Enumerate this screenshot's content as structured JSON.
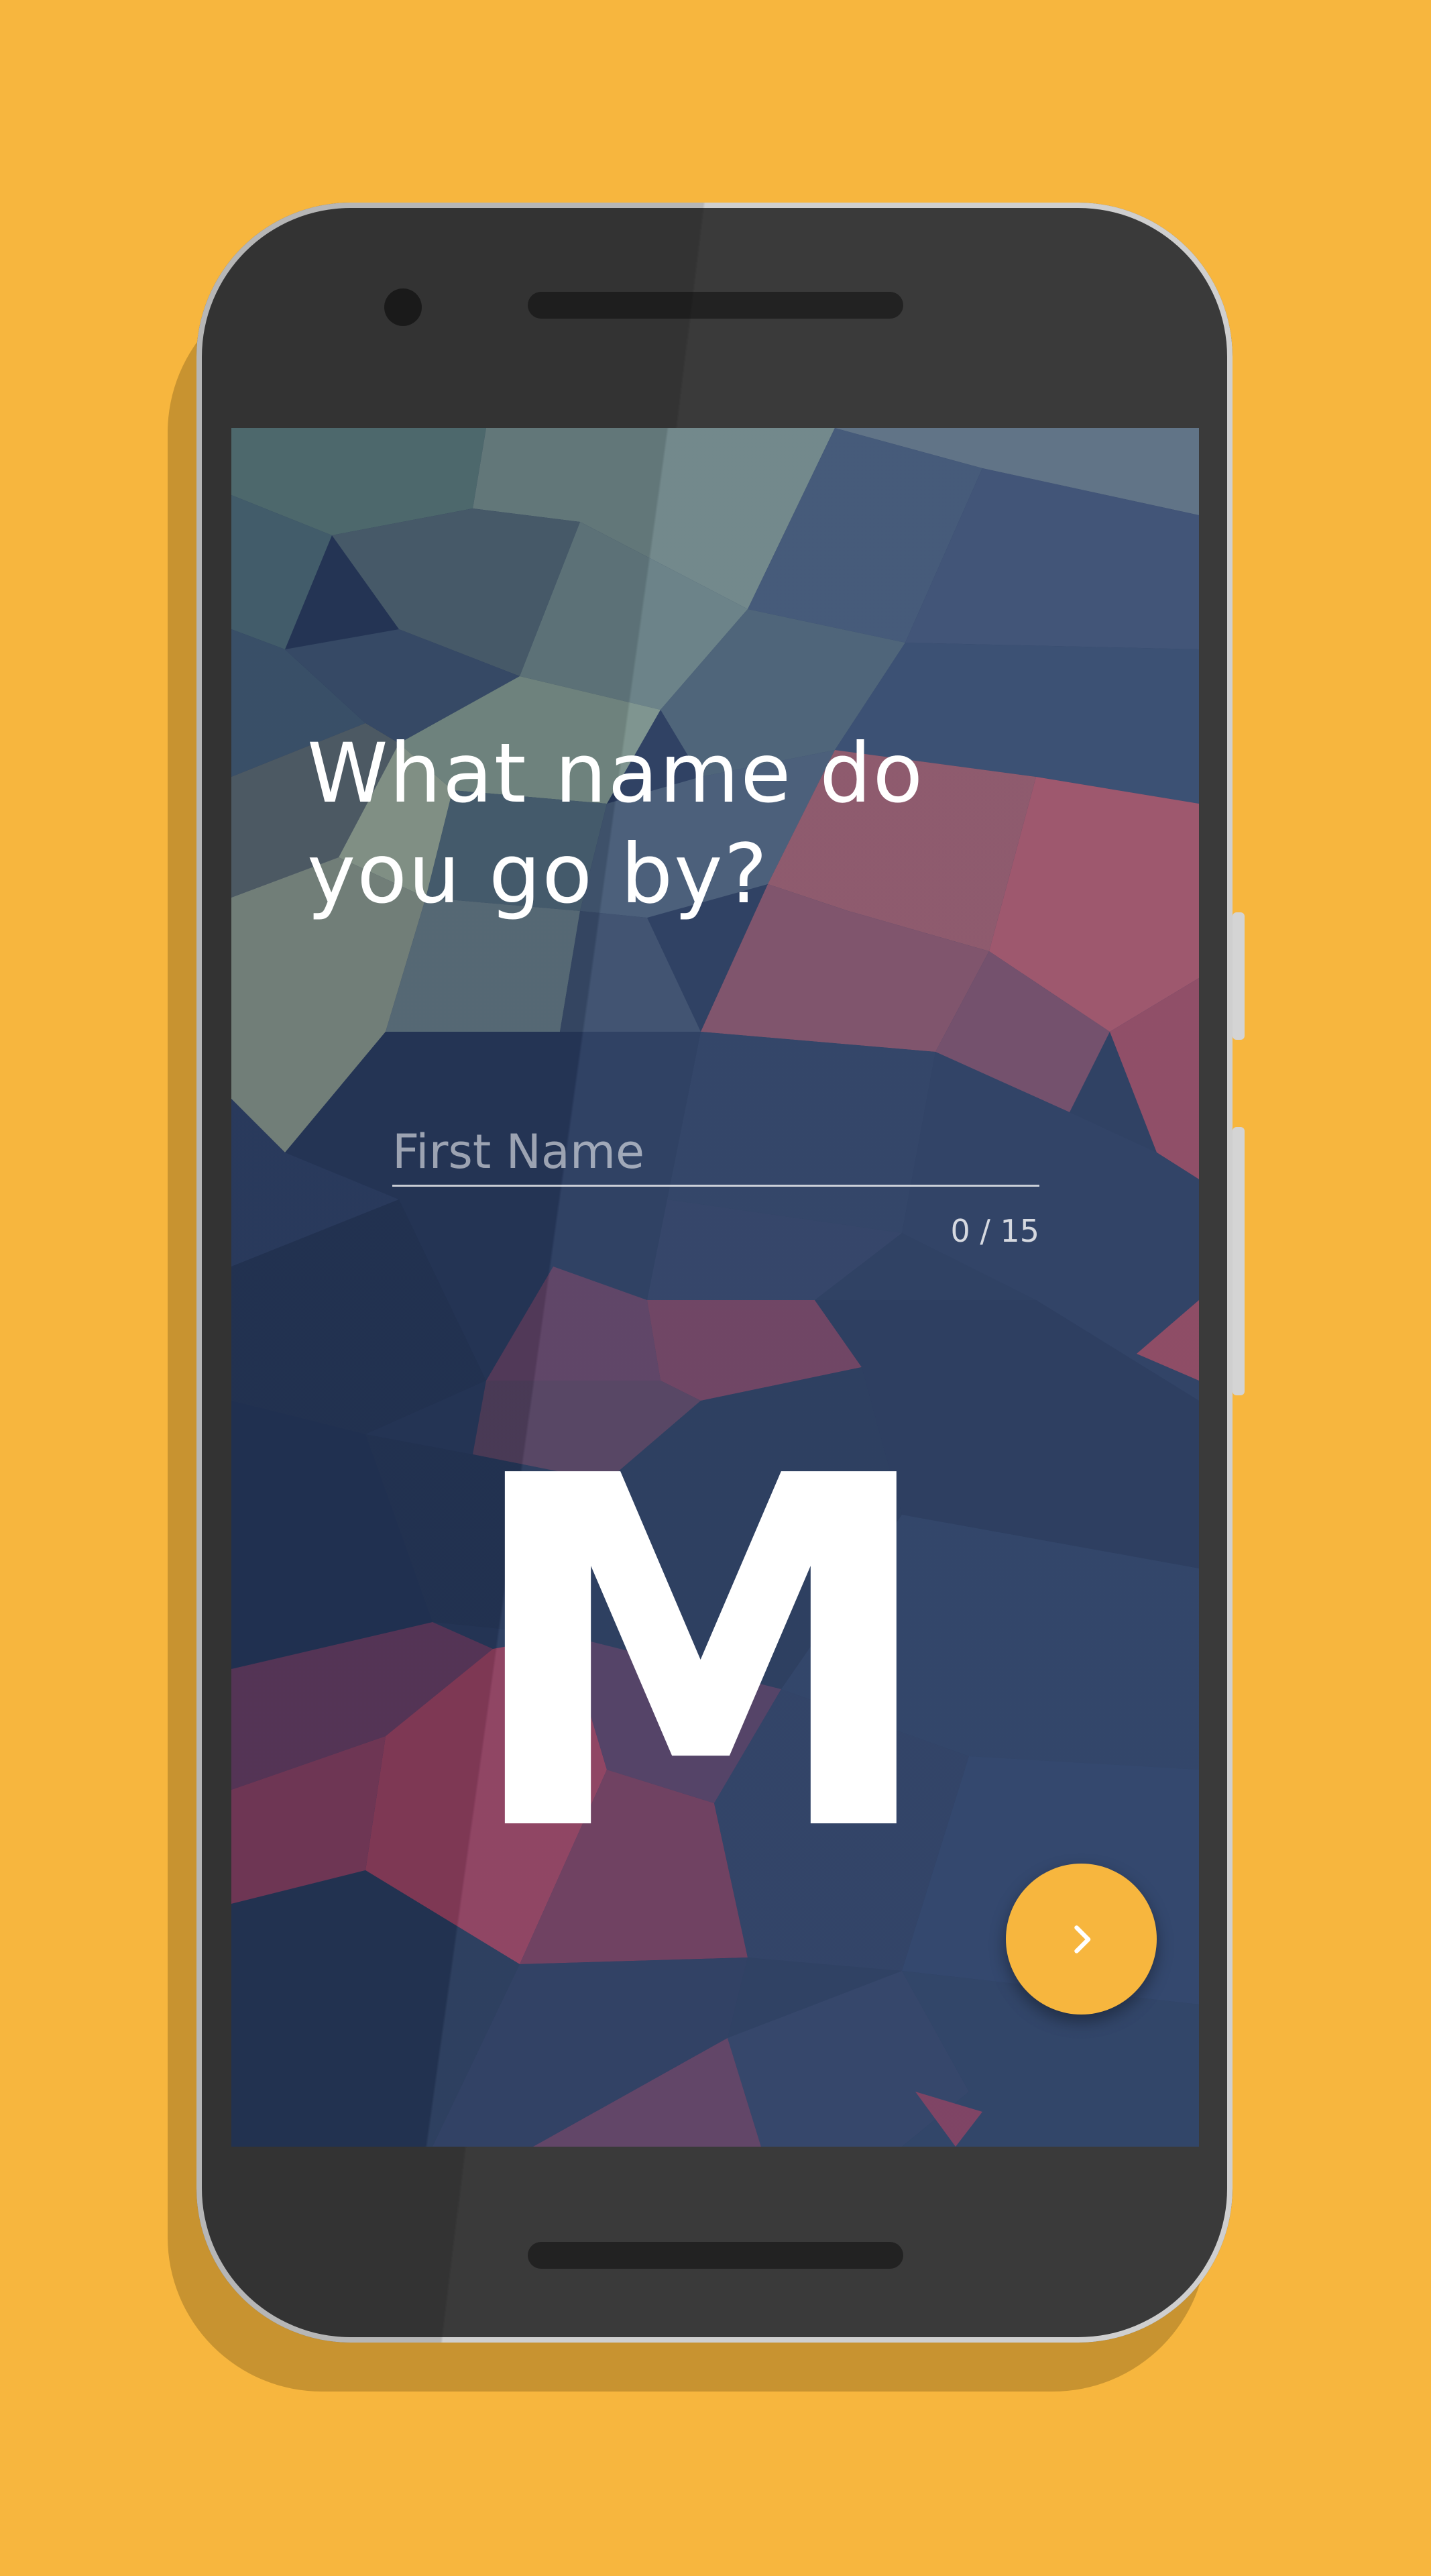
{
  "screen": {
    "title_line1": "What name do",
    "title_line2": "you go by?",
    "name_field": {
      "placeholder": "First Name",
      "value": ""
    },
    "char_counter": "0 / 15",
    "logo_letter": "M",
    "next_button": {
      "icon": "chevron-right-icon"
    }
  },
  "colors": {
    "background": "#F7B63E",
    "accent": "#F7B63E",
    "screen_base": "#27395C"
  }
}
